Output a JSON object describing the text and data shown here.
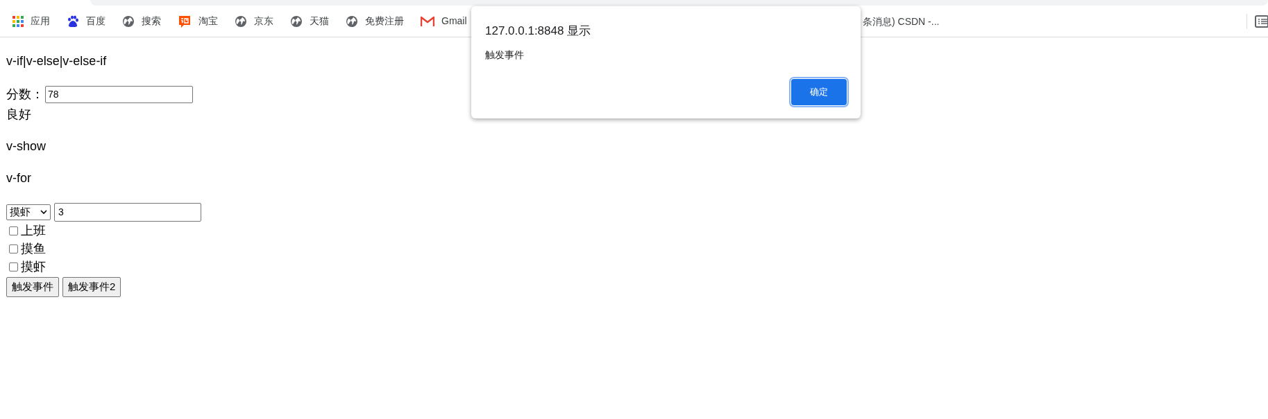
{
  "bookmarks": [
    {
      "label": "应用",
      "kind": "apps"
    },
    {
      "label": "百度",
      "kind": "paw"
    },
    {
      "label": "搜索",
      "kind": "site"
    },
    {
      "label": "淘宝",
      "kind": "shop"
    },
    {
      "label": "京东",
      "kind": "site"
    },
    {
      "label": "天猫",
      "kind": "site"
    },
    {
      "label": "免费注册",
      "kind": "site"
    },
    {
      "label": "Gmail",
      "kind": "mail"
    }
  ],
  "bookmark_partial": "条消息) CSDN -...",
  "page": {
    "heading_1": "v-if|v-else|v-else-if",
    "score_label": "分数：",
    "score_value": "78",
    "grade": "良好",
    "heading_2": "v-show",
    "heading_3": "v-for",
    "select_value": "摸虾",
    "count_value": "3",
    "checkboxes": [
      {
        "label": "上班",
        "checked": false
      },
      {
        "label": "摸鱼",
        "checked": false
      },
      {
        "label": "摸虾",
        "checked": false
      }
    ],
    "buttons": [
      "触发事件",
      "触发事件2"
    ]
  },
  "dialog": {
    "title": "127.0.0.1:8848 显示",
    "message": "触发事件",
    "ok": "确定"
  }
}
